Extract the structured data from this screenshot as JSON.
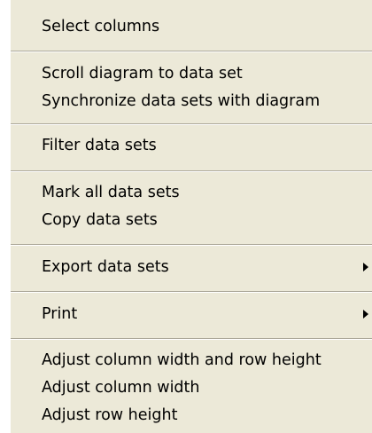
{
  "context_menu": {
    "items": [
      {
        "label": "Select columns"
      },
      {
        "label": "Scroll diagram to data set"
      },
      {
        "label": "Synchronize data sets with diagram"
      },
      {
        "label": "Filter data sets"
      },
      {
        "label": "Mark all data sets"
      },
      {
        "label": "Copy data sets"
      },
      {
        "label": "Export data sets",
        "submenu_icon": "submenu-arrow-icon"
      },
      {
        "label": "Print",
        "submenu_icon": "submenu-arrow-icon"
      },
      {
        "label": "Adjust column width and row height"
      },
      {
        "label": "Adjust column width"
      },
      {
        "label": "Adjust row height"
      }
    ]
  }
}
